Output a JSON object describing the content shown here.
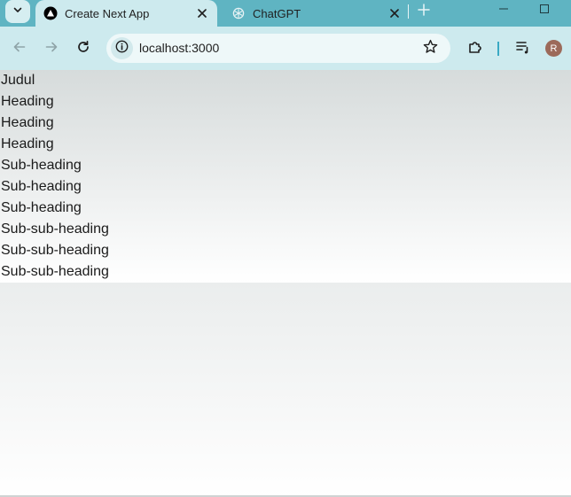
{
  "tabs": [
    {
      "title": "Create Next App",
      "active": true
    },
    {
      "title": "ChatGPT",
      "active": false
    }
  ],
  "address_bar": {
    "url": "localhost:3000"
  },
  "profile": {
    "initial": "R"
  },
  "content": {
    "lines": [
      "Judul",
      "Heading",
      "Heading",
      "Heading",
      "Sub-heading",
      "Sub-heading",
      "Sub-heading",
      "Sub-sub-heading",
      "Sub-sub-heading",
      "Sub-sub-heading"
    ]
  },
  "icons": {
    "tab_search": "chevron-down-icon",
    "tab1_favicon": "nextjs-icon",
    "tab2_favicon": "openai-icon",
    "close": "close-icon",
    "new_tab": "plus-icon",
    "minimize": "minimize-icon",
    "maximize": "maximize-icon",
    "back": "arrow-left-icon",
    "forward": "arrow-right-icon",
    "reload": "reload-icon",
    "site_info": "info-icon",
    "bookmark": "star-icon",
    "extensions": "puzzle-icon",
    "media": "playlist-icon"
  },
  "colors": {
    "tabstrip": "#5fb4c2",
    "toolbar": "#cdeaee",
    "omnibox": "#eef8f9",
    "avatar": "#9c6a5a"
  }
}
